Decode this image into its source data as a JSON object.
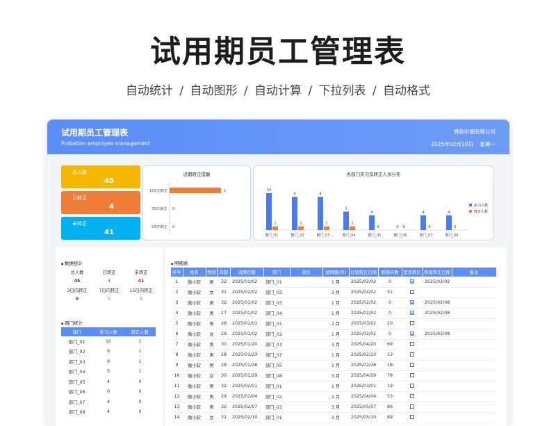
{
  "hero": {
    "title": "试用期员工管理表",
    "subtitle": "自动统计  /  自动图形  /  自动计算  /  下拉列表  /  自动格式"
  },
  "header": {
    "title": "试用期员工管理表",
    "subtitle": "Probation employee management",
    "company": "微软中国有限公司",
    "date": "2025年02月10日",
    "weekday": "星期一"
  },
  "kpis": [
    {
      "label": "总人数",
      "value": "45",
      "color": "#f5b800"
    },
    {
      "label": "已转正",
      "value": "4",
      "color": "#ef7d37"
    },
    {
      "label": "未转正",
      "value": "41",
      "color": "#00b0ef"
    }
  ],
  "reminder_chart": {
    "title": "近期转正提醒",
    "categories": [
      "15日内转正",
      "7日内转正",
      "3日内转正"
    ],
    "values": [
      1,
      0,
      0
    ],
    "max": 1,
    "color": "#ef7d37"
  },
  "chart_data": {
    "type": "bar",
    "title": "各部门实习及转正人员分布",
    "categories": [
      "部门_01",
      "部门_02",
      "部门_03",
      "部门_04",
      "部门_05",
      "部门_06",
      "部门_07",
      "部门_08"
    ],
    "series": [
      {
        "name": "实习人数",
        "values": [
          10,
          9,
          9,
          5,
          4,
          0,
          4,
          4
        ],
        "color": "#4a7cf0"
      },
      {
        "name": "转正人数",
        "values": [
          1,
          1,
          1,
          1,
          0,
          0,
          0,
          0
        ],
        "color": "#ef7d37"
      }
    ],
    "ylim": [
      0,
      10
    ],
    "legend": "right"
  },
  "stats": {
    "title": "数据统计",
    "row1_labels": [
      "总人数",
      "已转正",
      "未转正"
    ],
    "row1_values": [
      "45",
      "4",
      "41"
    ],
    "row2_labels": [
      "3日内转正",
      "7日内转正",
      "15日内转正"
    ],
    "row2_values": [
      "0",
      "0",
      "1"
    ]
  },
  "dept": {
    "title": "部门统计",
    "headers": [
      "部门",
      "实习人数",
      "转正人数"
    ],
    "rows": [
      [
        "部门_01",
        "10",
        "1"
      ],
      [
        "部门_02",
        "9",
        "1"
      ],
      [
        "部门_03",
        "9",
        "1"
      ],
      [
        "部门_04",
        "5",
        "1"
      ],
      [
        "部门_05",
        "4",
        "0"
      ],
      [
        "部门_06",
        "0",
        "0"
      ],
      [
        "部门_07",
        "4",
        "0"
      ],
      [
        "部门_08",
        "4",
        "0"
      ]
    ]
  },
  "detail": {
    "title": "明细表",
    "headers": [
      "序号",
      "姓名",
      "性别",
      "年龄",
      "试用日期",
      "部门",
      "岗位",
      "试用期(月)",
      "计划转正日期",
      "到期天数",
      "是否转正",
      "实际转正日期",
      "备注"
    ],
    "rows": [
      {
        "c": [
          "1",
          "微小软",
          "男",
          "32",
          "2025/01/02",
          "部门_01",
          "",
          "1 月",
          "2025/02/02",
          "0"
        ],
        "checked": true,
        "actual": "2025/02/02"
      },
      {
        "c": [
          "2",
          "微小软",
          "女",
          "31",
          "2025/01/02",
          "部门_02",
          "",
          "3 月",
          "2025/04/02",
          "51"
        ],
        "checked": false,
        "actual": ""
      },
      {
        "c": [
          "3",
          "微小软",
          "男",
          "32",
          "2025/01/02",
          "部门_03",
          "",
          "1 月",
          "2025/02/02",
          "0"
        ],
        "checked": true,
        "actual": "2025/02/08"
      },
      {
        "c": [
          "4",
          "微小软",
          "男",
          "27",
          "2025/01/02",
          "部门_04",
          "",
          "1 月",
          "2025/02/02",
          "0"
        ],
        "checked": true,
        "actual": "2025/02/08"
      },
      {
        "c": [
          "5",
          "微小软",
          "男",
          "28",
          "2025/01/01",
          "部门_01",
          "",
          "2 月",
          "2025/03/02",
          "20"
        ],
        "checked": false,
        "actual": ""
      },
      {
        "c": [
          "6",
          "微小软",
          "女",
          "29",
          "2025/01/02",
          "部门_02",
          "",
          "1 月",
          "2025/02/02",
          "0"
        ],
        "checked": true,
        "actual": "2025/02/08"
      },
      {
        "c": [
          "7",
          "微小软",
          "男",
          "30",
          "2025/01/20",
          "部门_03",
          "",
          "3 月",
          "2025/04/20",
          "69"
        ],
        "checked": false,
        "actual": ""
      },
      {
        "c": [
          "8",
          "微小软",
          "男",
          "28",
          "2025/01/23",
          "部门_07",
          "",
          "1 月",
          "2025/02/23",
          "13"
        ],
        "checked": false,
        "actual": ""
      },
      {
        "c": [
          "9",
          "微小软",
          "男",
          "28",
          "2025/01/26",
          "部门_05",
          "",
          "1 月",
          "2025/02/26",
          "16"
        ],
        "checked": false,
        "actual": ""
      },
      {
        "c": [
          "10",
          "微小软",
          "女",
          "30",
          "2025/01/29",
          "部门_08",
          "",
          "3 月",
          "2025/04/29",
          "78"
        ],
        "checked": false,
        "actual": ""
      },
      {
        "c": [
          "11",
          "微小软",
          "男",
          "32",
          "2025/02/01",
          "部门_01",
          "",
          "1 月",
          "2025/03/01",
          "19"
        ],
        "checked": false,
        "actual": ""
      },
      {
        "c": [
          "12",
          "微小软",
          "男",
          "29",
          "2025/02/04",
          "部门_02",
          "",
          "2 月",
          "2025/04/04",
          "53"
        ],
        "checked": false,
        "actual": ""
      },
      {
        "c": [
          "13",
          "微小软",
          "男",
          "32",
          "2025/02/07",
          "部门_03",
          "",
          "3 月",
          "2025/05/07",
          "86"
        ],
        "checked": false,
        "actual": ""
      },
      {
        "c": [
          "14",
          "微小软",
          "女",
          "32",
          "2025/02/10",
          "部门_01",
          "",
          "3 月",
          "2025/05/10",
          "89"
        ],
        "checked": false,
        "actual": ""
      }
    ]
  }
}
